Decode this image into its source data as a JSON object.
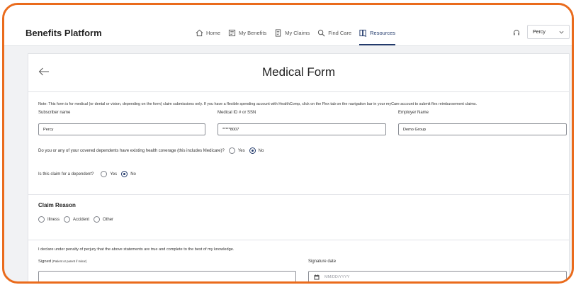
{
  "app": {
    "title": "Benefits Platform"
  },
  "nav": {
    "items": [
      {
        "label": "Home",
        "icon": "home-icon"
      },
      {
        "label": "My Benefits",
        "icon": "benefits-icon"
      },
      {
        "label": "My Claims",
        "icon": "claims-icon"
      },
      {
        "label": "Find Care",
        "icon": "search-icon"
      },
      {
        "label": "Resources",
        "icon": "resources-icon",
        "active": true
      }
    ]
  },
  "user": {
    "name": "Percy"
  },
  "form": {
    "title": "Medical Form",
    "note": "Note: This form is for medical (or dental or vision, depending on the form) claim submissions only. If you have a flexible spending account with HealthComp, click on the Flex tab on the navigation bar in your myCare account to submit flex reimbursement claims.",
    "subscriber_label": "Subscriber name",
    "subscriber_value": "Percy",
    "medical_id_label": "Medical ID # or SSN",
    "medical_id_value": "*****8007",
    "employer_label": "Employer Name",
    "employer_value": "Demo Group",
    "coverage_question": "Do you or any of your covered dependents have existing health coverage (this includes Medicare)?",
    "coverage_yes": "Yes",
    "coverage_no": "No",
    "coverage_selected": "No",
    "dependent_question": "Is this claim for a dependent?",
    "dependent_yes": "Yes",
    "dependent_no": "No",
    "dependent_selected": "No",
    "claim_reason_title": "Claim Reason",
    "reason_illness": "Illness",
    "reason_accident": "Accident",
    "reason_other": "Other",
    "declaration": "I declare under penalty of perjury that the above statements are true and complete to the best of my knowledge.",
    "signed_label": "Signed",
    "signed_hint": "(Patient or parent if minor)",
    "signature_date_label": "Signature date",
    "signature_date_placeholder": "MM/DD/YYYY"
  },
  "colors": {
    "accent": "#223a6b",
    "frame": "#ea6b1c"
  }
}
